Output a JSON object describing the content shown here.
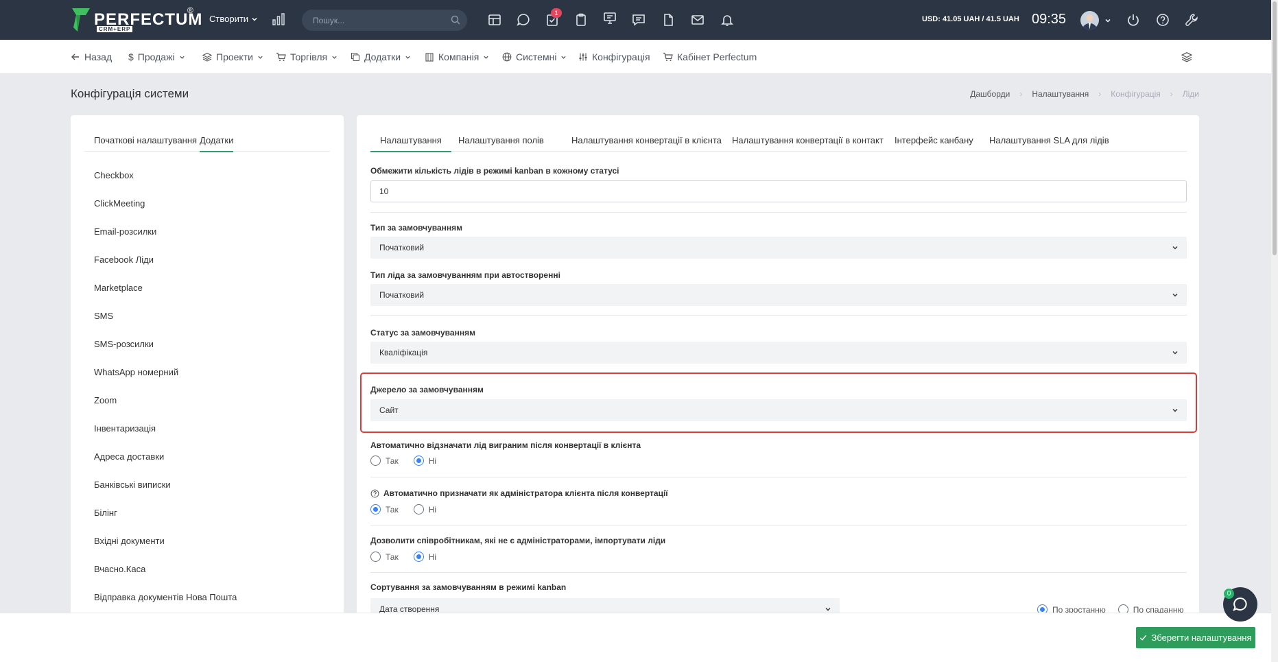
{
  "topbar": {
    "logo_text": "PERFECTUM",
    "logo_sub": "CRM+ERP",
    "logo_reg": "®",
    "create_label": "Створити",
    "search_placeholder": "Пошук...",
    "notification_count": "1",
    "currency": "USD: 41.05 UAH / 41.5 UAH",
    "time": "09:35"
  },
  "subnav": {
    "items": [
      {
        "label": "Назад",
        "icon": "arrow-left-icon"
      },
      {
        "label": "Продажі",
        "icon": "dollar-icon"
      },
      {
        "label": "Проекти",
        "icon": "layers-icon"
      },
      {
        "label": "Торгівля",
        "icon": "cart-icon"
      },
      {
        "label": "Додатки",
        "icon": "copy-icon"
      },
      {
        "label": "Компанія",
        "icon": "building-icon"
      },
      {
        "label": "Системні",
        "icon": "globe-icon"
      },
      {
        "label": "Конфігурація",
        "icon": "sliders-icon"
      },
      {
        "label": "Кабінет Perfectum",
        "icon": "cart-icon"
      }
    ]
  },
  "page": {
    "title": "Конфігурація системи",
    "breadcrumbs": [
      "Дашборди",
      "Налаштування",
      "Конфігурація",
      "Ліди"
    ]
  },
  "left": {
    "tabs": [
      "Початкові налаштування",
      "Додатки"
    ],
    "items": [
      "Checkbox",
      "ClickMeeting",
      "Email-розсилки",
      "Facebook Ліди",
      "Marketplace",
      "SMS",
      "SMS-розсилки",
      "WhatsApp номерний",
      "Zoom",
      "Інвентаризація",
      "Адреса доставки",
      "Банківські виписки",
      "Білінг",
      "Вхідні документи",
      "Вчасно.Каса",
      "Відправка документів Нова Пошта"
    ]
  },
  "right": {
    "tabs": [
      "Налаштування",
      "Налаштування полів",
      "Налаштування конвертації в клієнта",
      "Налаштування конвертації в контакт",
      "Інтерфейс канбану",
      "Налаштування SLA для лідів"
    ],
    "kanban_limit_label": "Обмежити кількість лідів в режимі kanban в кожному статусі",
    "kanban_limit_value": "10",
    "default_type_label": "Тип за замовчуванням",
    "default_type_value": "Початковий",
    "auto_type_label": "Тип ліда за замовчуванням при автостворенні",
    "auto_type_value": "Початковий",
    "default_status_label": "Статус за замовчуванням",
    "default_status_value": "Кваліфікація",
    "default_source_label": "Джерело за замовчуванням",
    "default_source_value": "Сайт",
    "auto_mark_lost_label": "Автоматично відзначати лід виграним після конвертації в клієнта",
    "auto_admin_label": "Автоматично призначати як адміністратора клієнта після конвертації",
    "allow_import_label": "Дозволити співробітникам, які не є адміністраторами, імпортувати ліди",
    "yes": "Так",
    "no": "Ні",
    "sort_label": "Сортування за замовчуванням в режимі kanban",
    "sort_value": "Дата створення",
    "sort_asc": "По зростанню",
    "sort_desc": "По спаданню"
  },
  "footer": {
    "save_label": "Зберегти налаштування",
    "chat_count": "0"
  }
}
